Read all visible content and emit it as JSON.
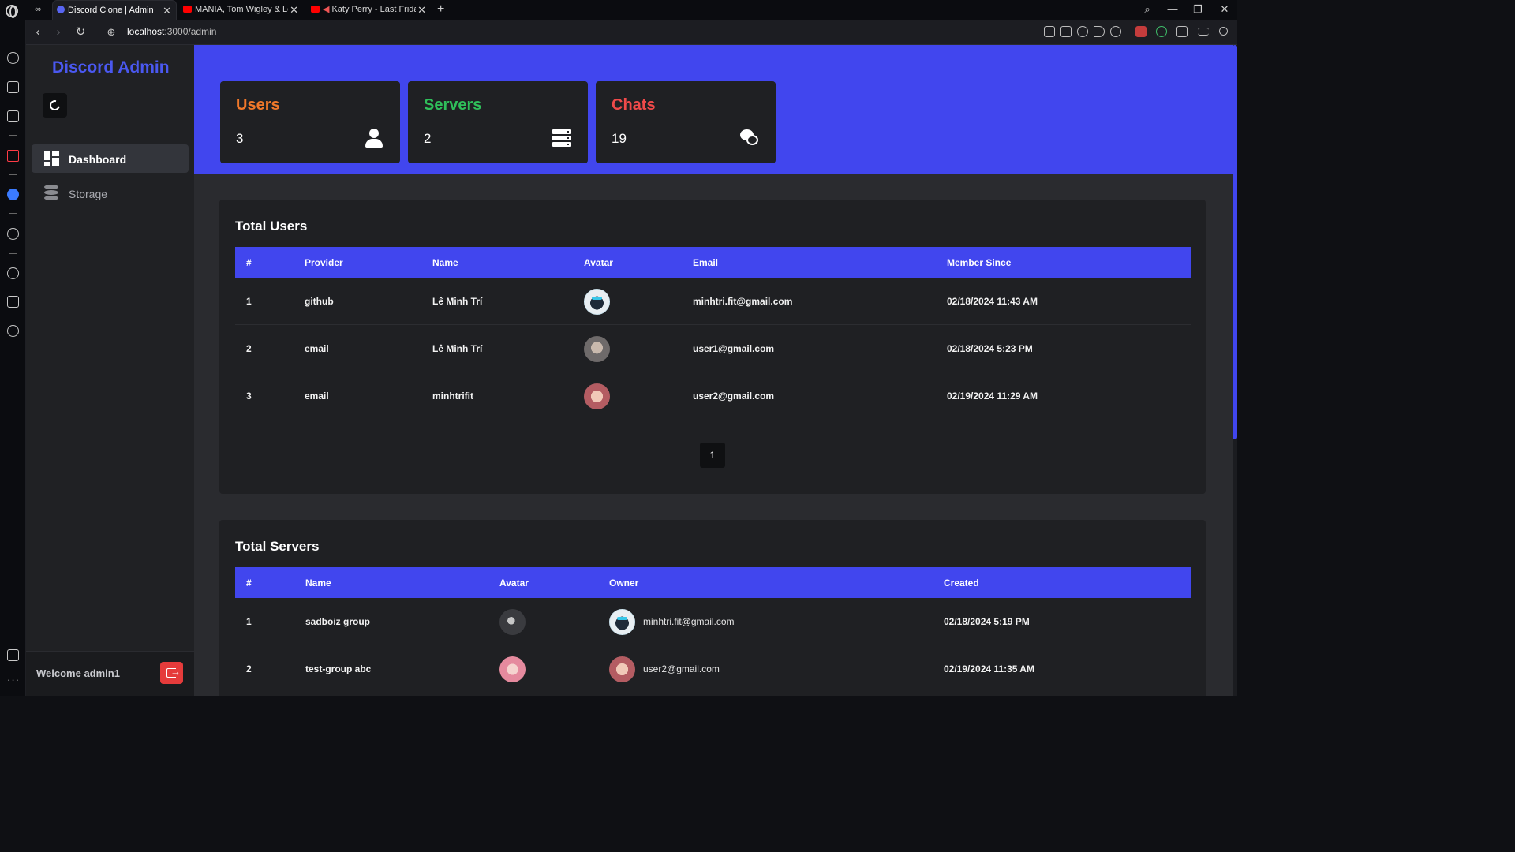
{
  "browser": {
    "tabs": [
      {
        "label": "Discord Clone | Admin",
        "active": true,
        "favicon": "discord-icon"
      },
      {
        "label": "MANIA, Tom Wigley & Lot",
        "active": false,
        "favicon": "youtube-icon"
      },
      {
        "label": "Katy Perry - Last Friday",
        "active": false,
        "favicon": "youtube-icon"
      }
    ],
    "new_tab_label": "+",
    "url_host": "localhost",
    "url_path": ":3000/admin"
  },
  "app": {
    "brand": "Discord Admin",
    "nav": [
      {
        "label": "Dashboard",
        "icon": "dashboard-icon",
        "active": true
      },
      {
        "label": "Storage",
        "icon": "database-icon",
        "active": false
      }
    ],
    "welcome": "Welcome admin1"
  },
  "stats": [
    {
      "title": "Users",
      "value": "3",
      "color": "#f0782a",
      "icon": "user-icon"
    },
    {
      "title": "Servers",
      "value": "2",
      "color": "#2fbf5a",
      "icon": "server-icon"
    },
    {
      "title": "Chats",
      "value": "19",
      "color": "#f04a4a",
      "icon": "chat-icon"
    }
  ],
  "users_table": {
    "title": "Total Users",
    "columns": [
      "#",
      "Provider",
      "Name",
      "Avatar",
      "Email",
      "Member Since"
    ],
    "rows": [
      {
        "index": "1",
        "provider": "github",
        "name": "Lê Minh Trí",
        "email": "minhtri.fit@gmail.com",
        "member_since": "02/18/2024 11:43 AM"
      },
      {
        "index": "2",
        "provider": "email",
        "name": "Lê Minh Trí",
        "email": "user1@gmail.com",
        "member_since": "02/18/2024 5:23 PM"
      },
      {
        "index": "3",
        "provider": "email",
        "name": "minhtrifit",
        "email": "user2@gmail.com",
        "member_since": "02/19/2024 11:29 AM"
      }
    ],
    "page": "1"
  },
  "servers_table": {
    "title": "Total Servers",
    "columns": [
      "#",
      "Name",
      "Avatar",
      "Owner",
      "Created"
    ],
    "rows": [
      {
        "index": "1",
        "name": "sadboiz group",
        "owner": "minhtri.fit@gmail.com",
        "created": "02/18/2024 5:19 PM"
      },
      {
        "index": "2",
        "name": "test-group abc",
        "owner": "user2@gmail.com",
        "created": "02/19/2024 11:35 AM"
      }
    ]
  },
  "colors": {
    "accent": "#4146ee",
    "brand": "#4a58f0",
    "logout": "#e53b3b"
  }
}
